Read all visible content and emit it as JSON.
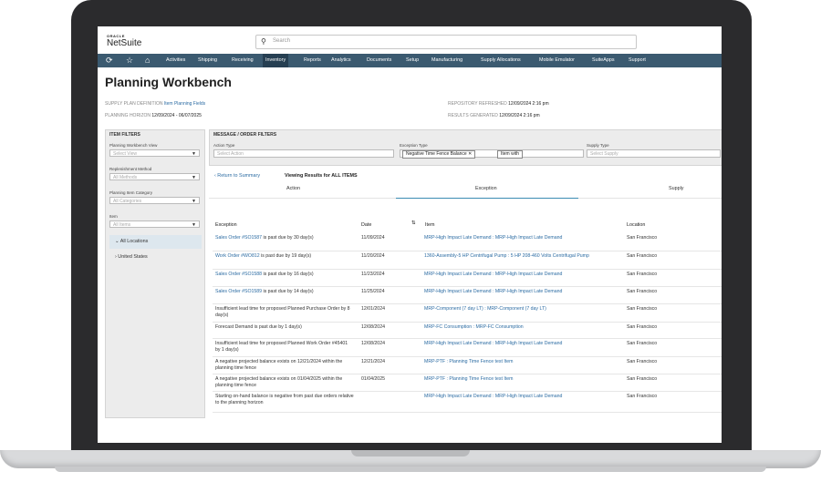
{
  "brand": {
    "oracle": "ORACLE",
    "netsuite": "NetSuite"
  },
  "search": {
    "placeholder": "Search"
  },
  "nav": {
    "items": [
      "Activities",
      "Shipping",
      "Receiving",
      "Inventory",
      "Reports",
      "Analytics",
      "Documents",
      "Setup",
      "Manufacturing",
      "Supply Allocations",
      "Mobile Emulator",
      "SuiteApps",
      "Support"
    ],
    "active": "Inventory"
  },
  "page": {
    "title": "Planning Workbench"
  },
  "meta": {
    "supply_plan_label": "SUPPLY PLAN DEFINITION",
    "supply_plan_value": "Item Planning Fields",
    "horizon_label": "PLANNING HORIZON",
    "horizon_value": "12/09/2024 - 06/07/2025",
    "refreshed_label": "REPOSITORY REFRESHED",
    "refreshed_value": "12/09/2024 2:16 pm",
    "generated_label": "RESULTS GENERATED",
    "generated_value": "12/09/2024 2:16 pm"
  },
  "item_filters": {
    "title": "ITEM FILTERS",
    "view_label": "Planning Workbench View",
    "view_value": "Select View",
    "method_label": "Replenishment Method",
    "method_value": "All Methods",
    "category_label": "Planning Item Category",
    "category_value": "All Categories",
    "item_label": "Item",
    "item_value": "All Items",
    "locations": [
      "All Locations",
      "United States"
    ]
  },
  "message_filters": {
    "title": "MESSAGE / ORDER FILTERS",
    "action_label": "Action Type",
    "action_value": "Select Action",
    "exception_label": "Exception Type",
    "exception_tags": [
      "Negative Time Fence Balance",
      "Item with"
    ],
    "supply_label": "Supply Type",
    "supply_value": "Select Supply"
  },
  "results": {
    "return": "Return to Summary",
    "viewing": "Viewing Results for ALL ITEMS",
    "tabs": [
      "Action",
      "Exception",
      "Supply"
    ],
    "headers": {
      "exception": "Exception",
      "date": "Date",
      "item": "Item",
      "location": "Location"
    },
    "rows": [
      {
        "link": "Sales Order #SO1587",
        "text": " is past due by 30 day(s)",
        "date": "11/09/2024",
        "item": "MRP-High Impact Late Demand : MRP-High Impact Late Demand",
        "location": "San Francisco"
      },
      {
        "link": "Work Order #WO812",
        "text": " is past due by 19 day(s)",
        "date": "11/20/2024",
        "item": "1360-Assembly-5 HP Centrifugal Pump : 5 HP 208-460 Volts Centrifugal Pump",
        "location": "San Francisco"
      },
      {
        "link": "Sales Order #SO1588",
        "text": " is past due by 16 day(s)",
        "date": "11/23/2024",
        "item": "MRP-High Impact Late Demand : MRP-High Impact Late Demand",
        "location": "San Francisco"
      },
      {
        "link": "Sales Order #SO1589",
        "text": " is past due by 14 day(s)",
        "date": "11/25/2024",
        "item": "MRP-High Impact Late Demand : MRP-High Impact Late Demand",
        "location": "San Francisco"
      },
      {
        "link": "",
        "text": "Insufficient lead time for proposed Planned Purchase Order by 8 day(s)",
        "date": "12/01/2024",
        "item": "MRP-Component (7 day LT) : MRP-Component (7 day LT)",
        "location": "San Francisco"
      },
      {
        "link": "",
        "text": "Forecast Demand is past due by 1 day(s)",
        "date": "12/08/2024",
        "item": "MRP-FC Consumption : MRP-FC Consumption",
        "location": "San Francisco"
      },
      {
        "link": "",
        "text": "Insufficient lead time for proposed Planned Work Order #45401 by 1 day(s)",
        "date": "12/08/2024",
        "item": "MRP-High Impact Late Demand : MRP-High Impact Late Demand",
        "location": "San Francisco"
      },
      {
        "link": "",
        "text": "A negative projected balance exists on 12/21/2024 within the planning time fence",
        "date": "12/21/2024",
        "item": "MRP-PTF : Planning Time Fence test Item",
        "location": "San Francisco"
      },
      {
        "link": "",
        "text": "A negative projected balance exists on 01/04/2025 within the planning time fence",
        "date": "01/04/2025",
        "item": "MRP-PTF : Planning Time Fence test Item",
        "location": "San Francisco"
      },
      {
        "link": "",
        "text": "Starting on-hand balance is negative from past due orders relative to the planning horizon",
        "date": "",
        "item": "MRP-High Impact Late Demand : MRP-High Impact Late Demand",
        "location": "San Francisco"
      }
    ]
  }
}
